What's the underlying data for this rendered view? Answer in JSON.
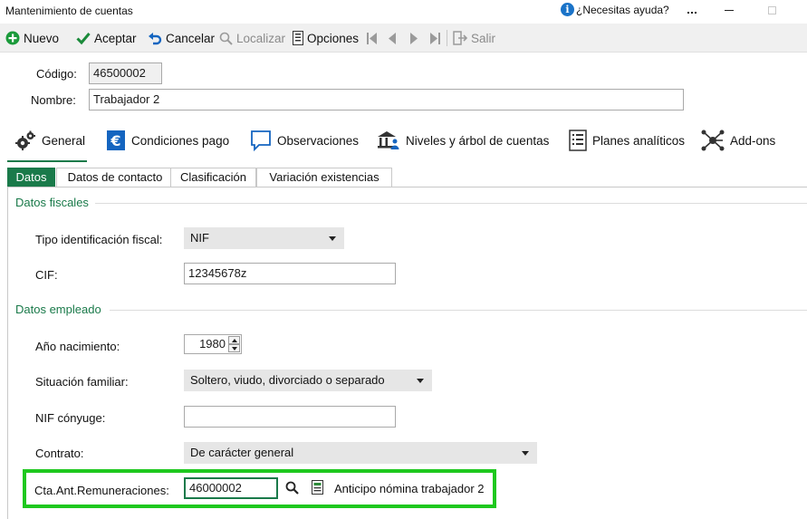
{
  "window": {
    "title": "Mantenimiento de cuentas",
    "help_label": "¿Necesitas ayuda?",
    "more_label": "..."
  },
  "toolbar": {
    "nuevo": "Nuevo",
    "aceptar": "Aceptar",
    "cancelar": "Cancelar",
    "localizar": "Localizar",
    "opciones": "Opciones",
    "salir": "Salir"
  },
  "header": {
    "codigo_label": "Código:",
    "codigo_value": "46500002",
    "nombre_label": "Nombre:",
    "nombre_value": "Trabajador 2"
  },
  "main_tabs": [
    {
      "label": "General",
      "icon": "gears-icon",
      "active": true
    },
    {
      "label": "Condiciones pago",
      "icon": "euro-icon",
      "active": false
    },
    {
      "label": "Observaciones",
      "icon": "speech-bubble-icon",
      "active": false
    },
    {
      "label": "Niveles y árbol de cuentas",
      "icon": "bank-users-icon",
      "active": false
    },
    {
      "label": "Planes analíticos",
      "icon": "list-document-icon",
      "active": false
    },
    {
      "label": "Add-ons",
      "icon": "network-icon",
      "active": false
    }
  ],
  "sub_tabs": [
    {
      "label": "Datos",
      "active": true
    },
    {
      "label": "Datos de contacto",
      "active": false
    },
    {
      "label": "Clasificación",
      "active": false
    },
    {
      "label": "Variación existencias",
      "active": false
    }
  ],
  "fiscal": {
    "section_title": "Datos fiscales",
    "tipo_label": "Tipo identificación fiscal:",
    "tipo_value": "NIF",
    "cif_label": "CIF:",
    "cif_value": "12345678z"
  },
  "empleado": {
    "section_title": "Datos empleado",
    "anio_label": "Año nacimiento:",
    "anio_value": "1980",
    "situacion_label": "Situación familiar:",
    "situacion_value": "Soltero, viudo, divorciado o separado",
    "nif_conyuge_label": "NIF cónyuge:",
    "nif_conyuge_value": "",
    "contrato_label": "Contrato:",
    "contrato_value": "De carácter general",
    "cta_label": "Cta.Ant.Remuneraciones:",
    "cta_value": "46000002",
    "cta_description": "Anticipo nómina trabajador 2"
  },
  "colors": {
    "accent_green": "#1a7a4a",
    "highlight_green": "#1ec81e",
    "help_blue": "#1a73c8"
  }
}
